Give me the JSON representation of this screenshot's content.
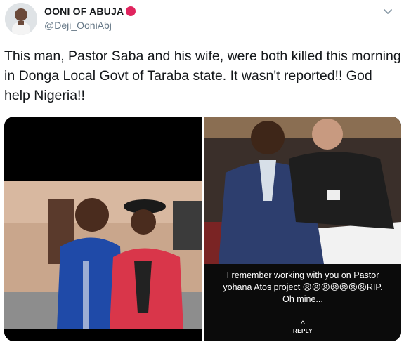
{
  "tweet": {
    "display_name": "OONI OF ABUJA",
    "handle": "@Deji_OoniAbj",
    "text": "This man, Pastor Saba and his wife, were both killed this morning in Donga Local Govt of Taraba state. It wasn't reported!! God help Nigeria!!"
  },
  "media": {
    "right_overlay": {
      "line1": "I remember working with you on Pastor",
      "line2": "yohana Atos project 😣😣😣😣😣😣😣RIP.",
      "line3": "Oh mine...",
      "reply_label": "REPLY"
    }
  },
  "colors": {
    "badge": "#e0245e",
    "handle": "#657786"
  }
}
